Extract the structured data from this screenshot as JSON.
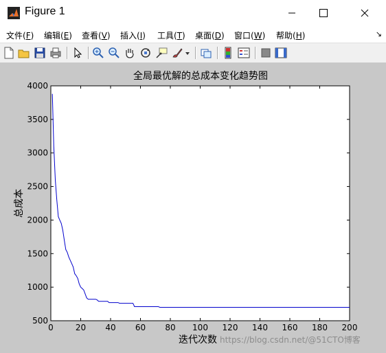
{
  "window": {
    "title": "Figure 1",
    "controls": [
      "minimize",
      "maximize",
      "close"
    ]
  },
  "menu": [
    {
      "text": "文件(",
      "key": "F",
      "close": ")"
    },
    {
      "text": "编辑(",
      "key": "E",
      "close": ")"
    },
    {
      "text": "查看(",
      "key": "V",
      "close": ")"
    },
    {
      "text": "插入(",
      "key": "I",
      "close": ")"
    },
    {
      "text": "工具(",
      "key": "T",
      "close": ")"
    },
    {
      "text": "桌面(",
      "key": "D",
      "close": ")"
    },
    {
      "text": "窗口(",
      "key": "W",
      "close": ")"
    },
    {
      "text": "帮助(",
      "key": "H",
      "close": ")"
    }
  ],
  "menu_overflow": "↘",
  "toolbar": {
    "icons": [
      "new-figure-icon",
      "open-file-icon",
      "save-icon",
      "print-icon",
      "pointer-icon",
      "zoom-in-icon",
      "zoom-out-icon",
      "pan-hand-icon",
      "rotate-3d-icon",
      "data-cursor-icon",
      "brush-icon",
      "link-plot-icon",
      "colorbar-icon",
      "legend-icon",
      "hide-plot-tools-icon",
      "show-plot-tools-icon"
    ]
  },
  "watermark": "https://blog.csdn.net/@51CTO博客",
  "colors": {
    "line": "#0000cc",
    "figure_bg": "#c8c8c8",
    "axes_bg": "#ffffff"
  },
  "chart_data": {
    "type": "line",
    "title": "全局最优解的总成本变化趋势图",
    "xlabel": "迭代次数",
    "ylabel": "总成本",
    "xlim": [
      0,
      200
    ],
    "ylim": [
      500,
      4000
    ],
    "xticks": [
      0,
      20,
      40,
      60,
      80,
      100,
      120,
      140,
      160,
      180,
      200
    ],
    "yticks": [
      500,
      1000,
      1500,
      2000,
      2500,
      3000,
      3500,
      4000
    ],
    "grid": false,
    "series": [
      {
        "color": "#0000cc",
        "points": [
          [
            1,
            3880
          ],
          [
            2,
            3100
          ],
          [
            3,
            2600
          ],
          [
            4,
            2300
          ],
          [
            5,
            2050
          ],
          [
            6,
            2000
          ],
          [
            7,
            1950
          ],
          [
            8,
            1850
          ],
          [
            9,
            1700
          ],
          [
            10,
            1560
          ],
          [
            11,
            1520
          ],
          [
            12,
            1450
          ],
          [
            13,
            1400
          ],
          [
            14,
            1350
          ],
          [
            15,
            1300
          ],
          [
            16,
            1200
          ],
          [
            17,
            1170
          ],
          [
            18,
            1130
          ],
          [
            19,
            1050
          ],
          [
            20,
            1000
          ],
          [
            21,
            980
          ],
          [
            22,
            960
          ],
          [
            23,
            900
          ],
          [
            24,
            840
          ],
          [
            25,
            820
          ],
          [
            30,
            820
          ],
          [
            31,
            810
          ],
          [
            32,
            790
          ],
          [
            38,
            790
          ],
          [
            39,
            770
          ],
          [
            45,
            770
          ],
          [
            46,
            760
          ],
          [
            55,
            760
          ],
          [
            56,
            710
          ],
          [
            72,
            710
          ],
          [
            73,
            700
          ],
          [
            200,
            700
          ]
        ]
      }
    ]
  }
}
